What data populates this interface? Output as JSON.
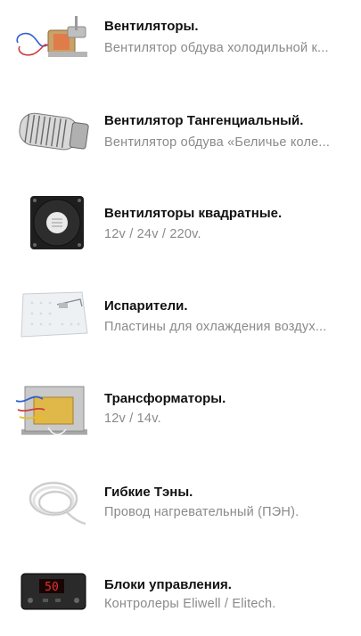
{
  "items": [
    {
      "title": "Вентиляторы.",
      "subtitle": "Вентилятор обдува холодильной к...",
      "icon": "fan-motor-icon"
    },
    {
      "title": "Вентилятор Тангенциальный.",
      "subtitle": "Вентилятор обдува «Беличье коле...",
      "icon": "tangential-fan-icon"
    },
    {
      "title": "Вентиляторы квадратные.",
      "subtitle": "12v / 24v / 220v.",
      "icon": "square-fan-icon"
    },
    {
      "title": "Испарители.",
      "subtitle": "Пластины для охлаждения воздух...",
      "icon": "evaporator-plate-icon"
    },
    {
      "title": "Трансформаторы.",
      "subtitle": "12v / 14v.",
      "icon": "transformer-icon"
    },
    {
      "title": "Гибкие Тэны.",
      "subtitle": "Провод нагревательный (ПЭН).",
      "icon": "heating-cable-icon"
    },
    {
      "title": "Блоки управления.",
      "subtitle": "Контролеры Eliwell / Elitech.",
      "icon": "controller-icon"
    }
  ],
  "colors": {
    "title": "#111111",
    "subtitle": "#8a8a8a",
    "display_red": "#e8322c"
  },
  "controller_display_value": "50"
}
